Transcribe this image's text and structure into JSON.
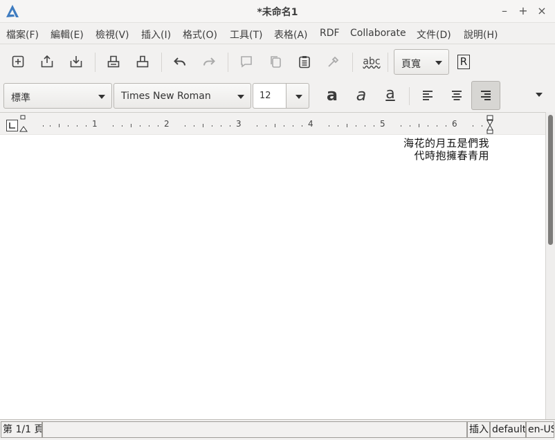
{
  "window": {
    "title": "*未命名1",
    "minimize": "–",
    "maximize": "+",
    "close": "×"
  },
  "menubar": {
    "items": [
      {
        "label": "檔案(F)"
      },
      {
        "label": "編輯(E)"
      },
      {
        "label": "檢視(V)"
      },
      {
        "label": "插入(I)"
      },
      {
        "label": "格式(O)"
      },
      {
        "label": "工具(T)"
      },
      {
        "label": "表格(A)"
      },
      {
        "label": "RDF"
      },
      {
        "label": "Collaborate"
      },
      {
        "label": "文件(D)"
      },
      {
        "label": "說明(H)"
      }
    ]
  },
  "toolbar": {
    "icons": [
      "new-document-icon",
      "open-icon",
      "save-icon",
      "print-icon",
      "print-preview-icon",
      "undo-icon",
      "redo-icon",
      "bookmark-icon",
      "copy-icon",
      "paste-icon",
      "format-painter-icon",
      "spellcheck-icon"
    ],
    "spellcheck_label": "abc",
    "zoom_value": "頁寬",
    "reveal_codes_label": "R"
  },
  "format_bar": {
    "style_value": "標準",
    "font_value": "Times New Roman",
    "size_value": "12",
    "bold_glyph": "a",
    "italic_glyph": "a",
    "underline_glyph": "a",
    "active_alignment": "right"
  },
  "ruler": {
    "numbers": [
      "1",
      "2",
      "3",
      "4",
      "5",
      "6"
    ]
  },
  "document": {
    "lines": [
      "海花的月五是們我",
      "代時抱擁春青用"
    ]
  },
  "status": {
    "page": "第 1/1 頁",
    "mode": "插入",
    "style": "default",
    "language": "en-US"
  },
  "colors": {
    "logo": "#3f7cc0",
    "active_button": "#d7d6d3",
    "scroll_thumb": "#7d7c7a"
  }
}
